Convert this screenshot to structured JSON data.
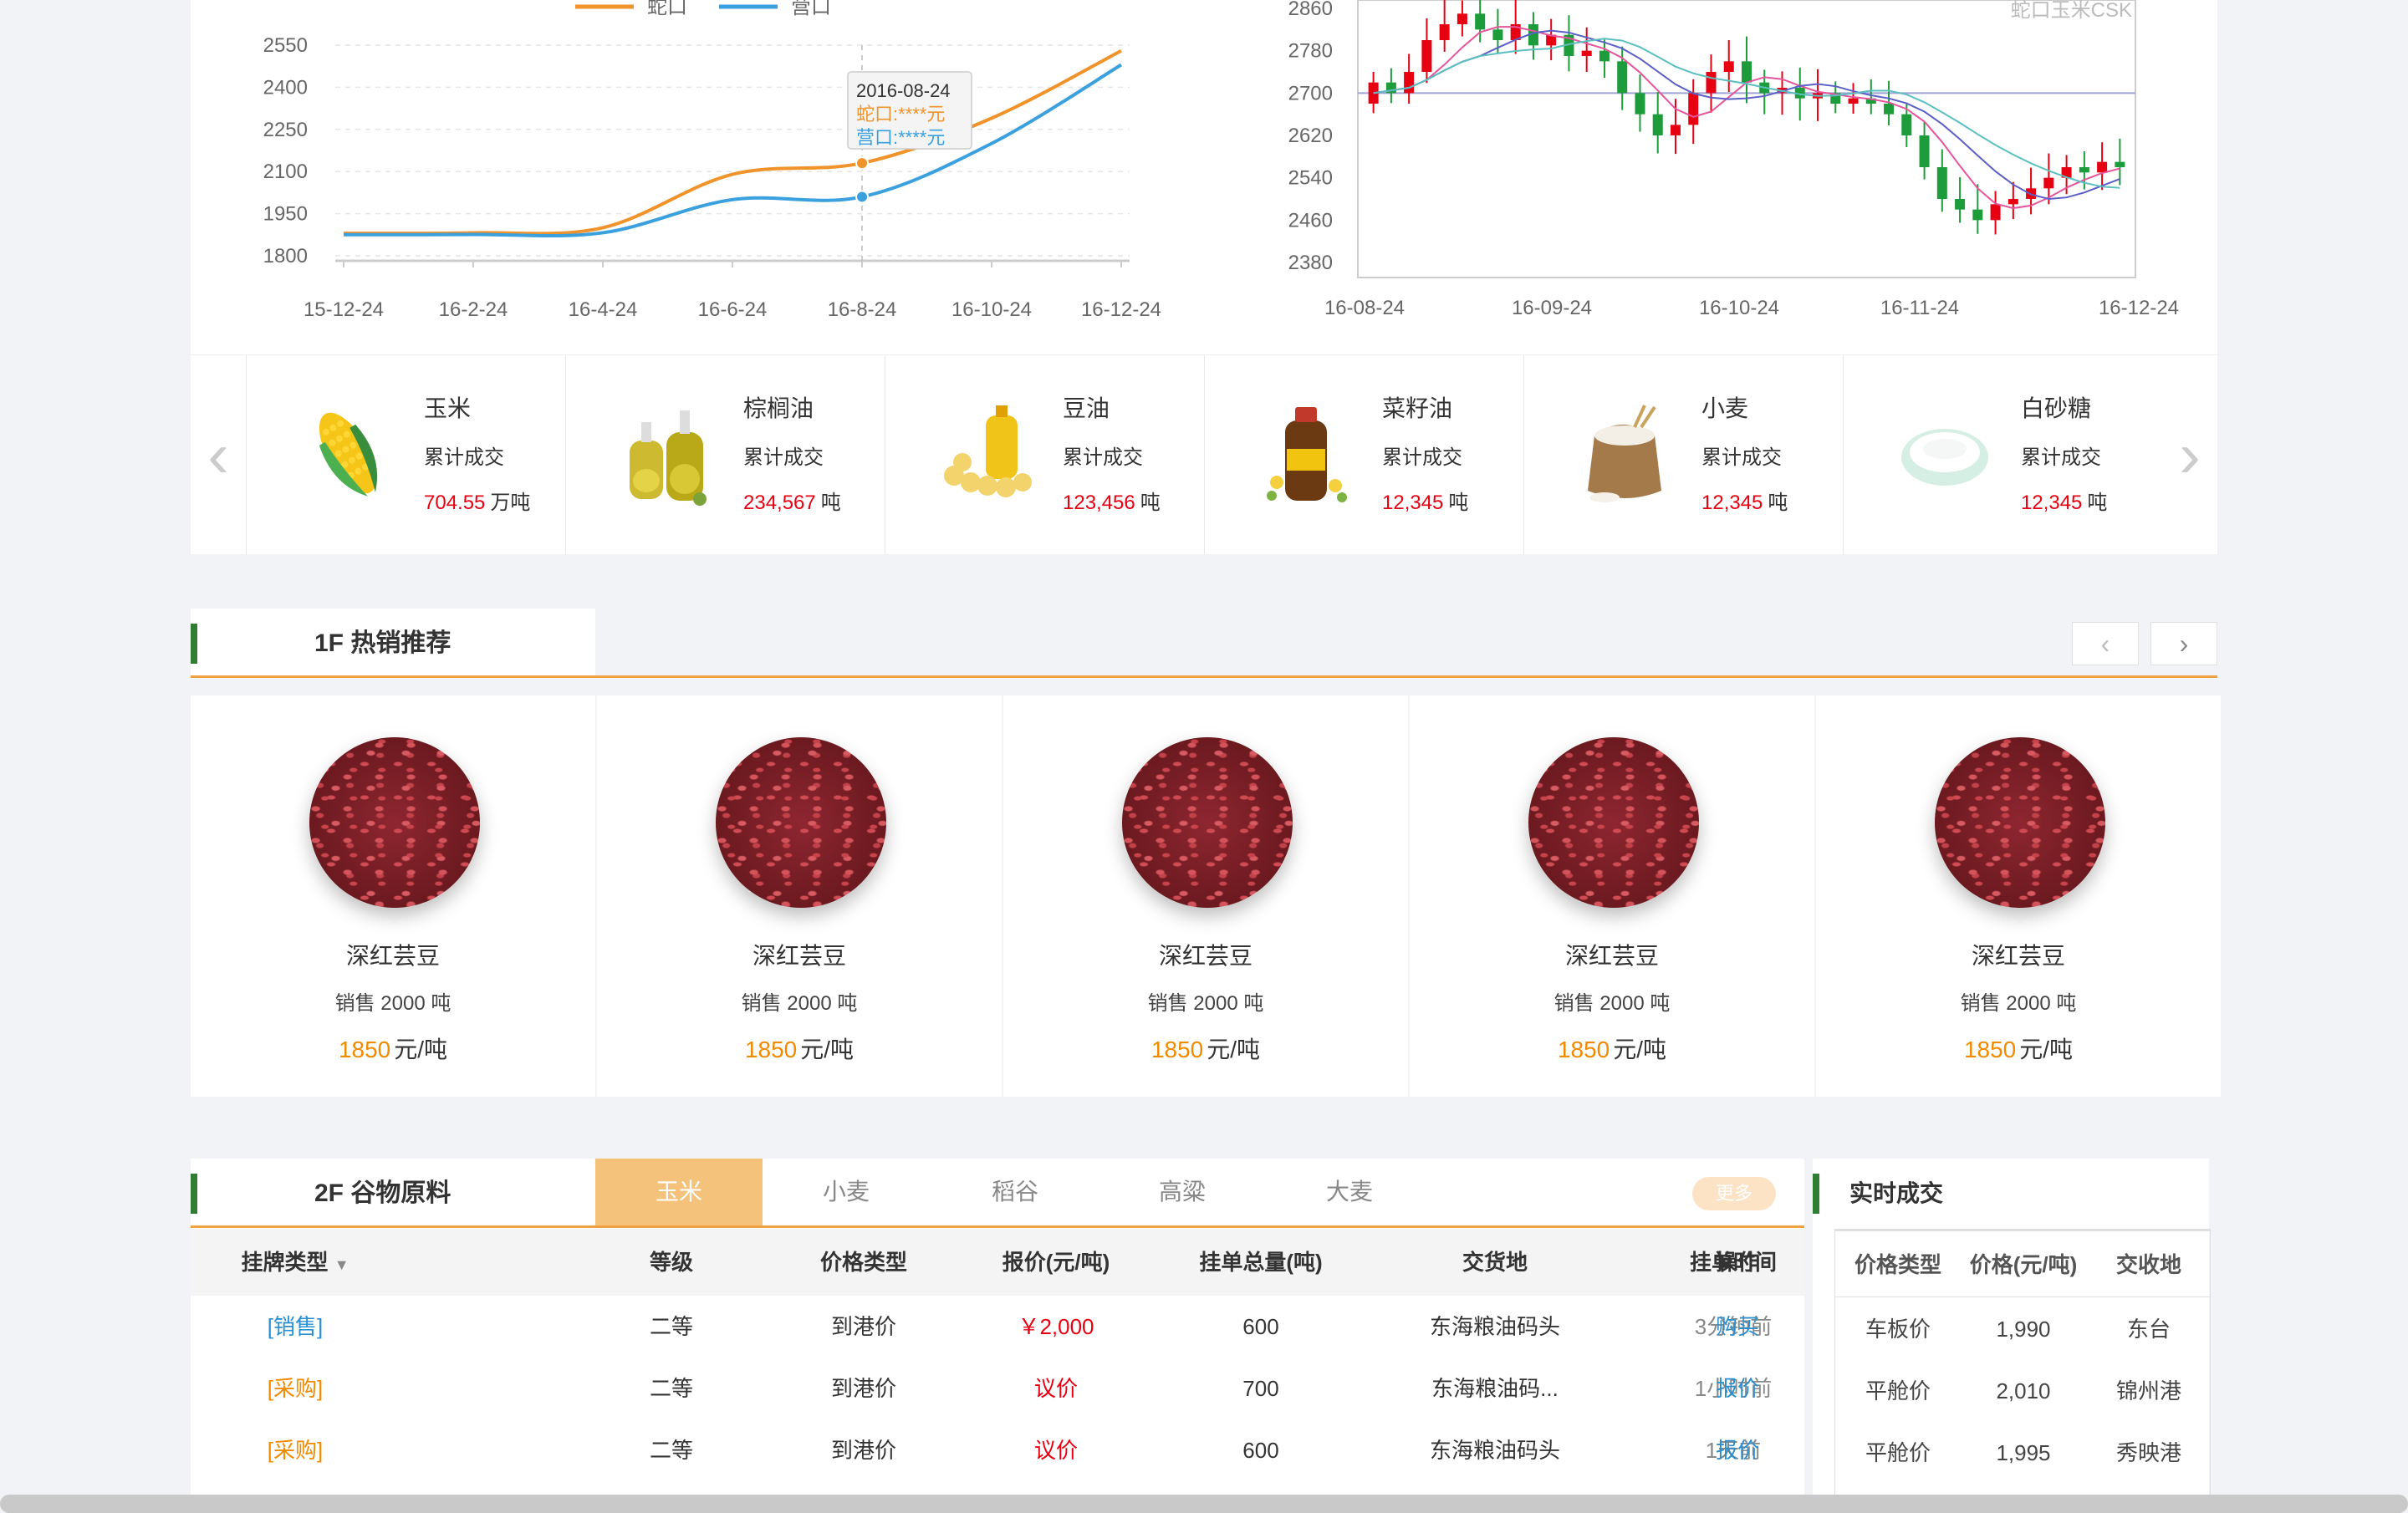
{
  "line_chart": {
    "legend": [
      "蛇口",
      "营口"
    ],
    "colors": {
      "series1": "#f0932b",
      "series2": "#3aa0de"
    },
    "yticks": [
      "2550",
      "2400",
      "2250",
      "2100",
      "1950",
      "1800"
    ],
    "xticks": [
      "15-12-24",
      "16-2-24",
      "16-4-24",
      "16-6-24",
      "16-8-24",
      "16-10-24",
      "16-12-24"
    ],
    "tooltip": {
      "date": "2016-08-24",
      "line1": "蛇口:****元",
      "line2": "营口:****元"
    }
  },
  "kline_chart": {
    "watermark": "蛇口玉米CSK",
    "yticks": [
      "2860",
      "2780",
      "2700",
      "2620",
      "2540",
      "2460",
      "2380"
    ],
    "xticks": [
      "16-08-24",
      "16-09-24",
      "16-10-24",
      "16-11-24",
      "16-12-24"
    ],
    "up_color": "#e60012",
    "down_color": "#1c9c3a"
  },
  "chart_data": [
    {
      "type": "line",
      "x": [
        "15-12-24",
        "16-2-24",
        "16-4-24",
        "16-6-24",
        "16-8-24",
        "16-10-24",
        "16-12-24"
      ],
      "series": [
        {
          "name": "蛇口",
          "values": [
            1880,
            1882,
            1900,
            2090,
            2130,
            2290,
            2530
          ]
        },
        {
          "name": "营口",
          "values": [
            1875,
            1876,
            1882,
            2000,
            2010,
            2200,
            2480
          ]
        }
      ],
      "ylim": [
        1800,
        2550
      ]
    },
    {
      "type": "candlestick",
      "x": [
        "16-08-24",
        "16-09-24",
        "16-10-24",
        "16-11-24",
        "16-12-24"
      ],
      "ylim": [
        2380,
        2860
      ]
    }
  ],
  "commodities": [
    {
      "name": "玉米",
      "label": "累计成交",
      "value": "704.55",
      "unit": "万吨",
      "icon": "corn"
    },
    {
      "name": "棕榈油",
      "label": "累计成交",
      "value": "234,567",
      "unit": "吨",
      "icon": "oil-bottles"
    },
    {
      "name": "豆油",
      "label": "累计成交",
      "value": "123,456",
      "unit": "吨",
      "icon": "soy"
    },
    {
      "name": "菜籽油",
      "label": "累计成交",
      "value": "12,345",
      "unit": "吨",
      "icon": "rapeseed-oil"
    },
    {
      "name": "小麦",
      "label": "累计成交",
      "value": "12,345",
      "unit": "吨",
      "icon": "wheat-sack"
    },
    {
      "name": "白砂糖",
      "label": "累计成交",
      "value": "12,345",
      "unit": "吨",
      "icon": "sugar"
    }
  ],
  "hot": {
    "title": "1F  热销推荐",
    "products": [
      {
        "name": "深红芸豆",
        "sales": "销售 2000 吨",
        "price": "1850",
        "unit": "元/吨"
      },
      {
        "name": "深红芸豆",
        "sales": "销售 2000 吨",
        "price": "1850",
        "unit": "元/吨"
      },
      {
        "name": "深红芸豆",
        "sales": "销售 2000 吨",
        "price": "1850",
        "unit": "元/吨"
      },
      {
        "name": "深红芸豆",
        "sales": "销售 2000 吨",
        "price": "1850",
        "unit": "元/吨"
      },
      {
        "name": "深红芸豆",
        "sales": "销售 2000 吨",
        "price": "1850",
        "unit": "元/吨"
      }
    ]
  },
  "grain": {
    "title": "2F  谷物原料",
    "tabs": [
      "玉米",
      "小麦",
      "稻谷",
      "高粱",
      "大麦"
    ],
    "more": "更多",
    "headers": [
      "挂牌类型",
      "等级",
      "价格类型",
      "报价(元/吨)",
      "挂单总量(吨)",
      "交货地",
      "挂单时间",
      "操作"
    ],
    "rows": [
      {
        "type": "[销售]",
        "grade": "二等",
        "price_type": "到港价",
        "price": "￥2,000",
        "qty": "600",
        "place": "东海粮油码头",
        "time": "3分钟前",
        "op": "购买"
      },
      {
        "type": "[采购]",
        "grade": "二等",
        "price_type": "到港价",
        "price": "议价",
        "qty": "700",
        "place": "东海粮油码...",
        "time": "1小时前",
        "op": "报价"
      },
      {
        "type": "[采购]",
        "grade": "二等",
        "price_type": "到港价",
        "price": "议价",
        "qty": "600",
        "place": "东海粮油码头",
        "time": "1天前",
        "op": "报价"
      }
    ]
  },
  "realtime": {
    "title": "实时成交",
    "headers": [
      "价格类型",
      "价格(元/吨)",
      "交收地"
    ],
    "rows": [
      [
        "车板价",
        "1,990",
        "东台"
      ],
      [
        "平舱价",
        "2,010",
        "锦州港"
      ],
      [
        "平舱价",
        "1,995",
        "秀映港"
      ]
    ]
  }
}
